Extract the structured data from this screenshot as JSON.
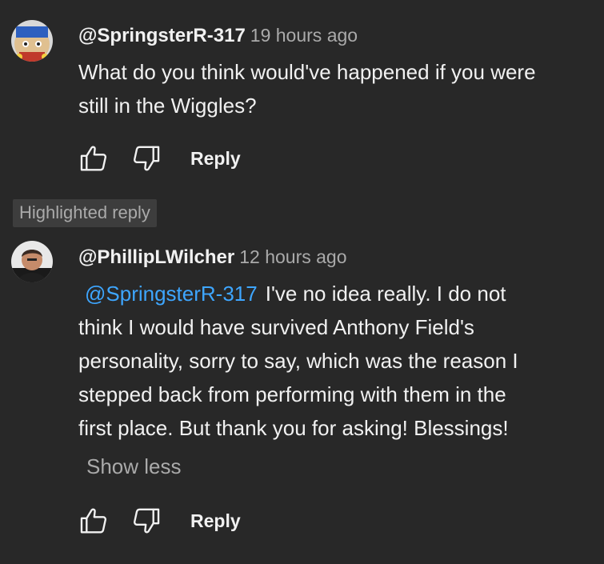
{
  "comment": {
    "handle": "@SpringsterR-317",
    "time": "19 hours ago",
    "text_line1": "What do you think would've happened if you were",
    "text_line2": "still in the Wiggles?",
    "reply_label": "Reply"
  },
  "highlight_badge": "Highlighted reply",
  "reply": {
    "handle": "@PhillipLWilcher",
    "time": "12 hours ago",
    "mention": "@SpringsterR-317",
    "text_line1": "I've no idea really. I do not",
    "text_line2": "think I would have survived Anthony Field's",
    "text_line3": "personality, sorry to say, which was the reason I",
    "text_line4": "stepped back from performing with them in the",
    "text_line5": "first place. But thank you for asking! Blessings!",
    "show_less": "Show less",
    "reply_label": "Reply"
  },
  "icons": {
    "like": "thumbs-up-icon",
    "dislike": "thumbs-down-icon"
  },
  "colors": {
    "background": "#282828",
    "text": "#f1f1f1",
    "secondary_text": "#aaaaaa",
    "mention": "#3ea6ff",
    "badge_bg": "#3d3d3d"
  }
}
